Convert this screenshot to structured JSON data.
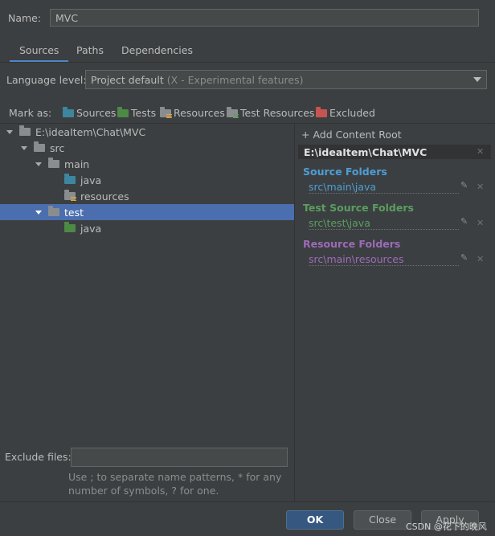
{
  "name": {
    "label": "Name:",
    "value": "MVC"
  },
  "tabs": [
    {
      "label": "Sources",
      "active": true
    },
    {
      "label": "Paths",
      "active": false
    },
    {
      "label": "Dependencies",
      "active": false
    }
  ],
  "language": {
    "label": "Language level:",
    "value": "Project default",
    "hint": "(X - Experimental features)"
  },
  "mark_as": {
    "label": "Mark as:",
    "items": [
      {
        "label": "Sources",
        "icon": "sources-folder-icon"
      },
      {
        "label": "Tests",
        "icon": "tests-folder-icon"
      },
      {
        "label": "Resources",
        "icon": "resources-folder-icon"
      },
      {
        "label": "Test Resources",
        "icon": "test-resources-folder-icon"
      },
      {
        "label": "Excluded",
        "icon": "excluded-folder-icon"
      }
    ]
  },
  "tree": [
    {
      "label": "E:\\ideaItem\\Chat\\MVC",
      "expanded": true,
      "icon": "folder-icon"
    },
    {
      "label": "src",
      "expanded": true,
      "icon": "folder-icon"
    },
    {
      "label": "main",
      "expanded": true,
      "icon": "folder-icon"
    },
    {
      "label": "java",
      "icon": "source-folder-icon"
    },
    {
      "label": "resources",
      "icon": "resources-folder-icon"
    },
    {
      "label": "test",
      "expanded": true,
      "selected": true,
      "icon": "folder-icon"
    },
    {
      "label": "java",
      "icon": "test-source-folder-icon"
    }
  ],
  "right_pane": {
    "add_root": "+ Add Content Root",
    "root": "E:\\ideaItem\\Chat\\MVC",
    "sections": [
      {
        "title": "Source Folders",
        "path": "src\\main\\java",
        "color": "#4e9ed6"
      },
      {
        "title": "Test Source Folders",
        "path": "src\\test\\java",
        "color": "#5a9e5f"
      },
      {
        "title": "Resource Folders",
        "path": "src\\main\\resources",
        "color": "#9d6bb8"
      }
    ]
  },
  "exclude": {
    "label": "Exclude files:",
    "hint": "Use ; to separate name patterns, * for any number of symbols, ? for one."
  },
  "buttons": {
    "ok": "OK",
    "close": "Close",
    "apply": "Apply"
  },
  "watermark": "CSDN @花下的晚风"
}
